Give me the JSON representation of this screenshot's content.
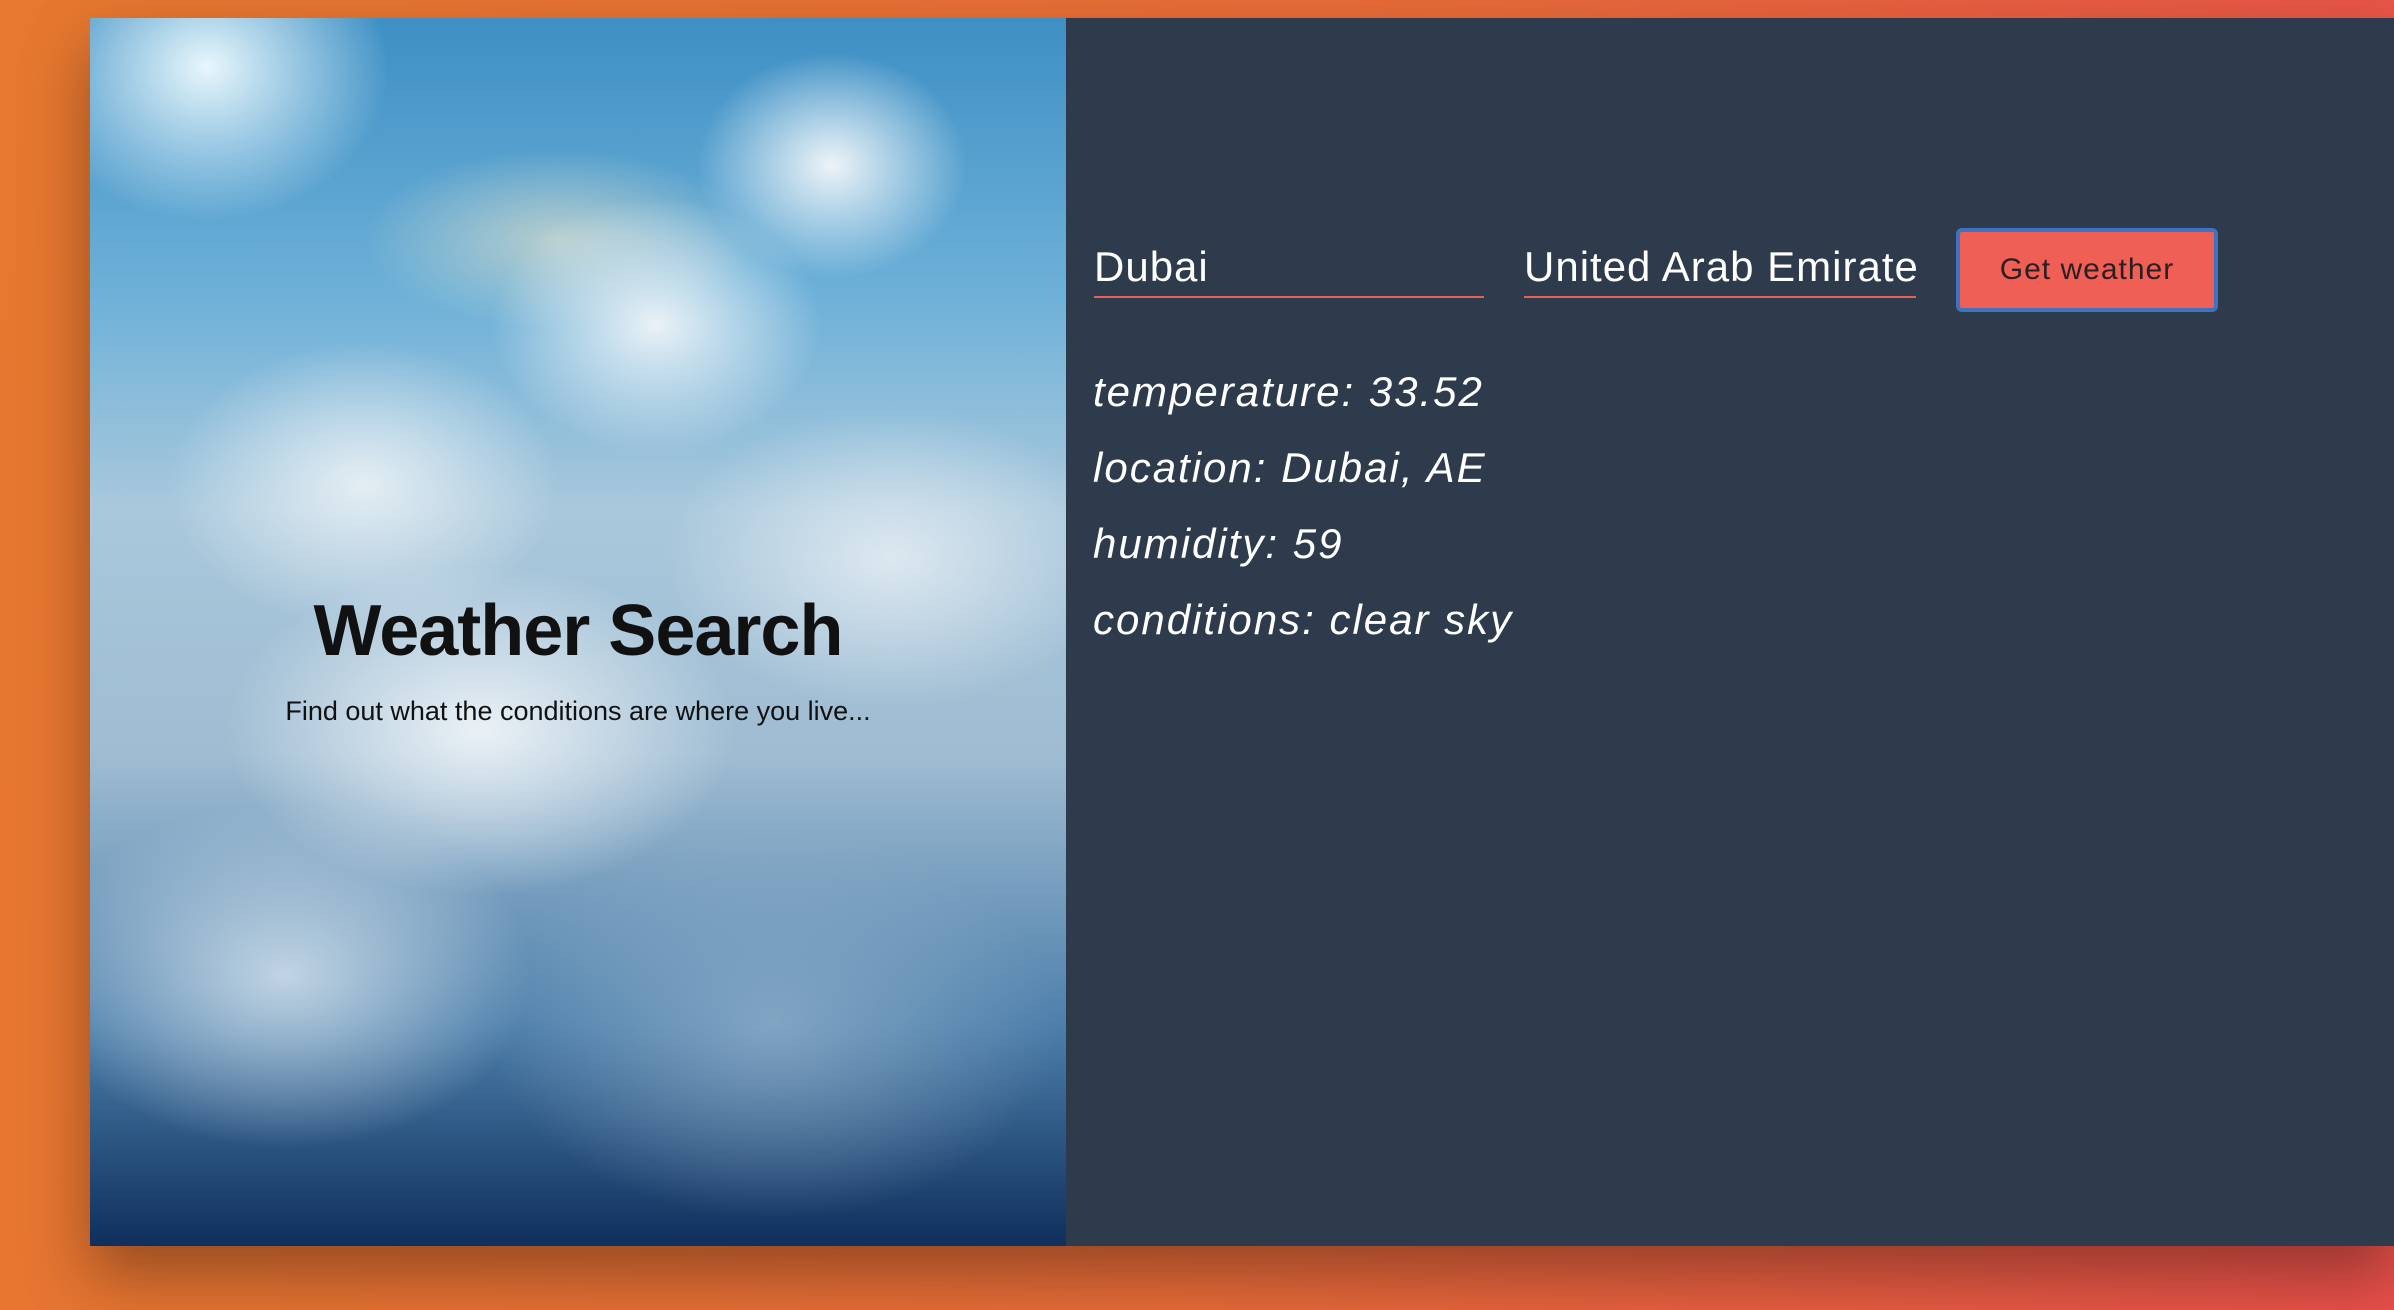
{
  "hero": {
    "title": "Weather Search",
    "subtitle": "Find out what the conditions are where you live..."
  },
  "form": {
    "city_value": "Dubai",
    "country_value": "United Arab Emirate",
    "submit_label": "Get weather"
  },
  "results": {
    "temperature": "temperature: 33.52",
    "location": "location: Dubai, AE",
    "humidity": "humidity: 59",
    "conditions": "conditions: clear sky"
  },
  "colors": {
    "background_gradient_start": "#e6782f",
    "background_gradient_end": "#e8504a",
    "panel_background": "#2e3b4d",
    "accent": "#ef5f55",
    "focus_ring": "#3f72c0"
  }
}
